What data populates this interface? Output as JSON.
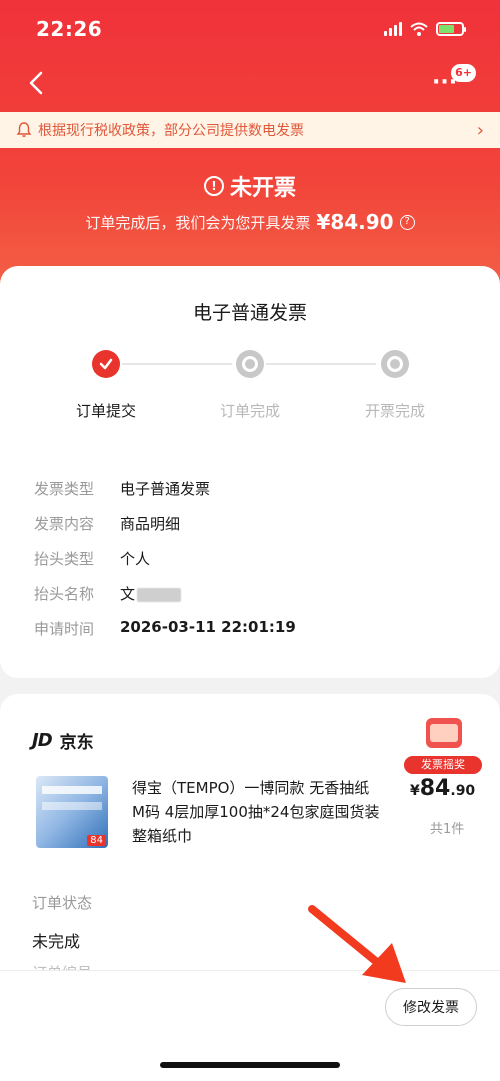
{
  "status_bar": {
    "time": "22:26"
  },
  "nav": {
    "badge": "6+"
  },
  "notice": {
    "text": "根据现行税收政策，部分公司提供数电发票"
  },
  "invoice_status": {
    "title": "未开票",
    "description": "订单完成后，我们会为您开具发票",
    "amount": "¥84.90"
  },
  "invoice_card": {
    "title": "电子普通发票",
    "steps": [
      {
        "label": "订单提交",
        "state": "done"
      },
      {
        "label": "订单完成",
        "state": "pending"
      },
      {
        "label": "开票完成",
        "state": "pending"
      }
    ],
    "details": [
      {
        "key": "发票类型",
        "value": "电子普通发票"
      },
      {
        "key": "发票内容",
        "value": "商品明细"
      },
      {
        "key": "抬头类型",
        "value": "个人"
      },
      {
        "key": "抬头名称",
        "value": "文"
      },
      {
        "key": "申请时间",
        "value": "2026-03-11 22:01:19"
      }
    ]
  },
  "order_card": {
    "shop_logo": "JD",
    "shop_name": "京东",
    "product_title": "得宝（TEMPO）一博同款 无香抽纸 M码 4层加厚100抽*24包家庭囤货装 整箱纸巾",
    "product_image_tag": "84",
    "gift_badge": "发票摇奖",
    "price_currency": "¥",
    "price_int": "84",
    "price_dec": ".90",
    "quantity": "共1件",
    "order_status_label": "订单状态",
    "order_status_value": "未完成",
    "order_number_label": "订单编号"
  },
  "bottom": {
    "edit_button": "修改发票"
  },
  "colors": {
    "brand_red": "#e8342d",
    "header_gradient_top": "#f0323a",
    "notice_bg": "#fff4e6",
    "notice_text": "#e0573a"
  }
}
